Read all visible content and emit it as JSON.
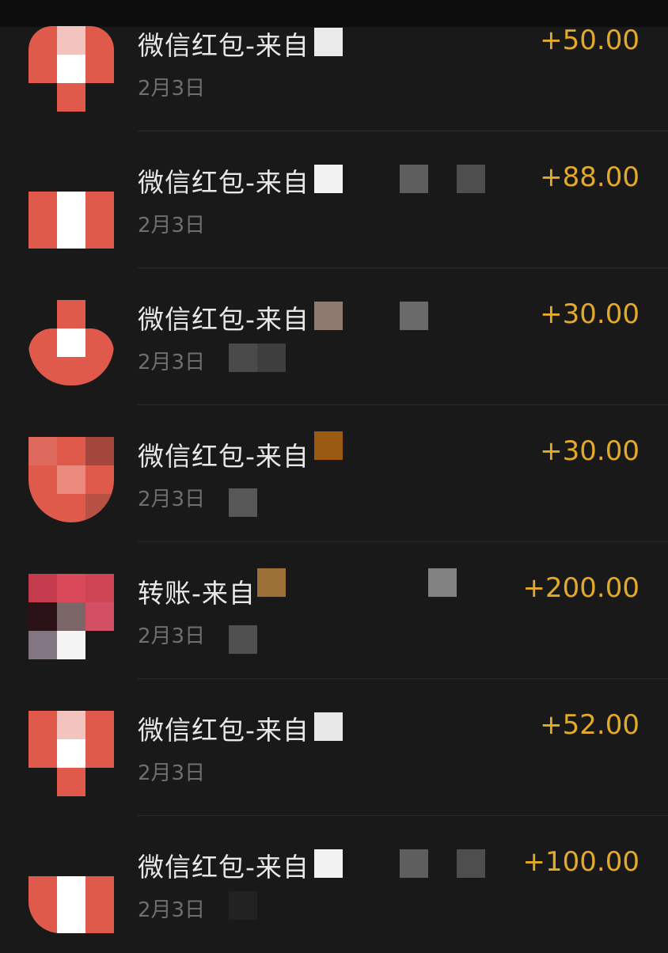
{
  "colors": {
    "background": "#191919",
    "amount": "#e2a92a",
    "title": "#e8e8e8",
    "date": "#6f6f6f",
    "envelope_red": "#e05a4b"
  },
  "transactions": [
    {
      "title": "微信红包-来自",
      "date": "2月3日",
      "amount": "+50.00",
      "icon": "red-packet-icon"
    },
    {
      "title": "微信红包-来自",
      "date": "2月3日",
      "amount": "+88.00",
      "icon": "red-packet-icon"
    },
    {
      "title": "微信红包-来自",
      "date": "2月3日",
      "amount": "+30.00",
      "icon": "red-packet-icon"
    },
    {
      "title": "微信红包-来自",
      "date": "2月3日",
      "amount": "+30.00",
      "icon": "red-packet-icon"
    },
    {
      "title": "转账-来自",
      "date": "2月3日",
      "amount": "+200.00",
      "icon": "transfer-avatar-icon"
    },
    {
      "title": "微信红包-来自",
      "date": "2月3日",
      "amount": "+52.00",
      "icon": "red-packet-icon"
    },
    {
      "title": "微信红包-来自",
      "date": "2月3日",
      "amount": "+100.00",
      "icon": "red-packet-icon"
    }
  ]
}
